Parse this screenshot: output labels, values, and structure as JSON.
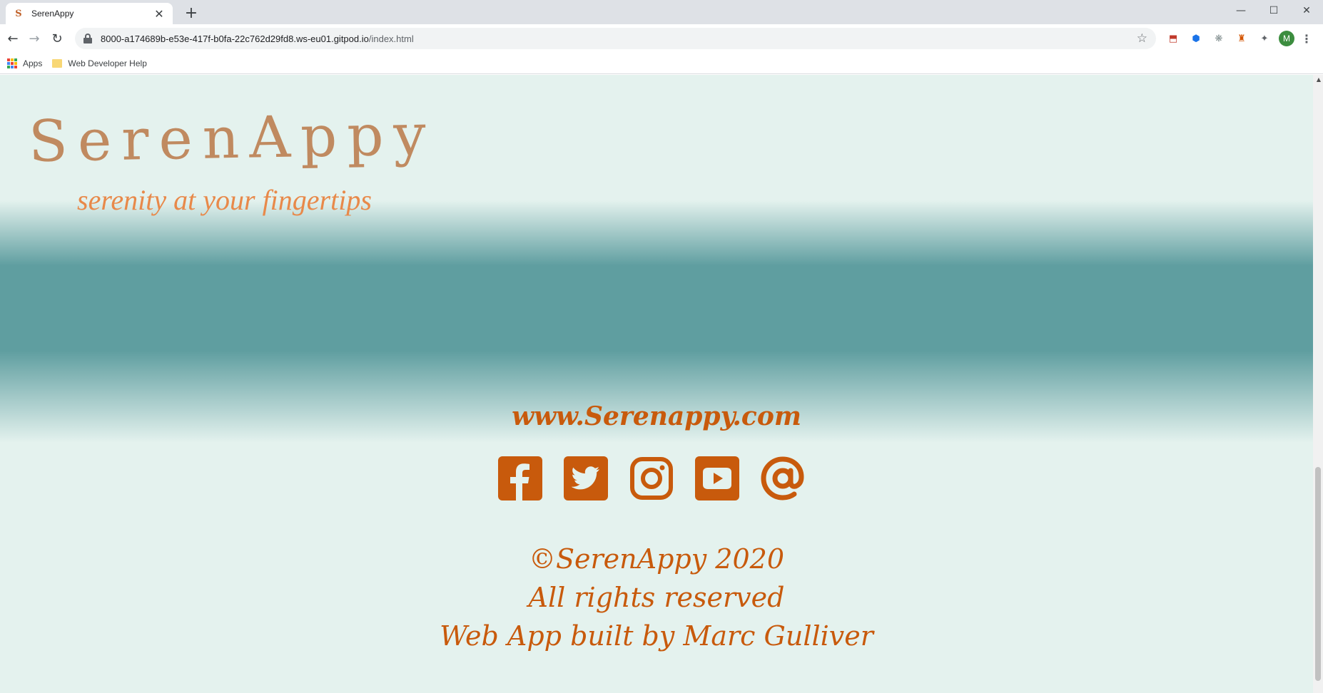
{
  "browser": {
    "tab_title": "SerenAppy",
    "favicon_letter": "S",
    "tab_close": "✕",
    "new_tab": "+",
    "win_min": "—",
    "win_max": "☐",
    "win_close": "✕",
    "back": "←",
    "forward": "→",
    "reload": "↻",
    "url_host": "8000-a174689b-e53e-417f-b0fa-22c762d29fd8.ws-eu01.gitpod.io",
    "url_path": "/index.html",
    "star": "☆",
    "avatar_letter": "M",
    "menu": "⋮",
    "extensions": [
      "⬒",
      "⬢",
      "❋",
      "♜",
      "✦"
    ]
  },
  "bookmarks": {
    "apps_label": "Apps",
    "folder_label": "Web Developer Help"
  },
  "page": {
    "logo": "SerenAppy",
    "tagline": "serenity at your fingertips",
    "footer_url": "www.Serenappy.com",
    "copyright": "©SerenAppy 2020",
    "rights": "All rights reserved",
    "credit": "Web App built by Marc Gulliver"
  },
  "socials": [
    "facebook",
    "twitter",
    "instagram",
    "youtube",
    "email"
  ],
  "colors": {
    "accent": "#c85a0c",
    "band": "#5f9ea0",
    "background": "#e4f2ee",
    "logo": "#c08a60",
    "tagline": "#e8894a"
  }
}
